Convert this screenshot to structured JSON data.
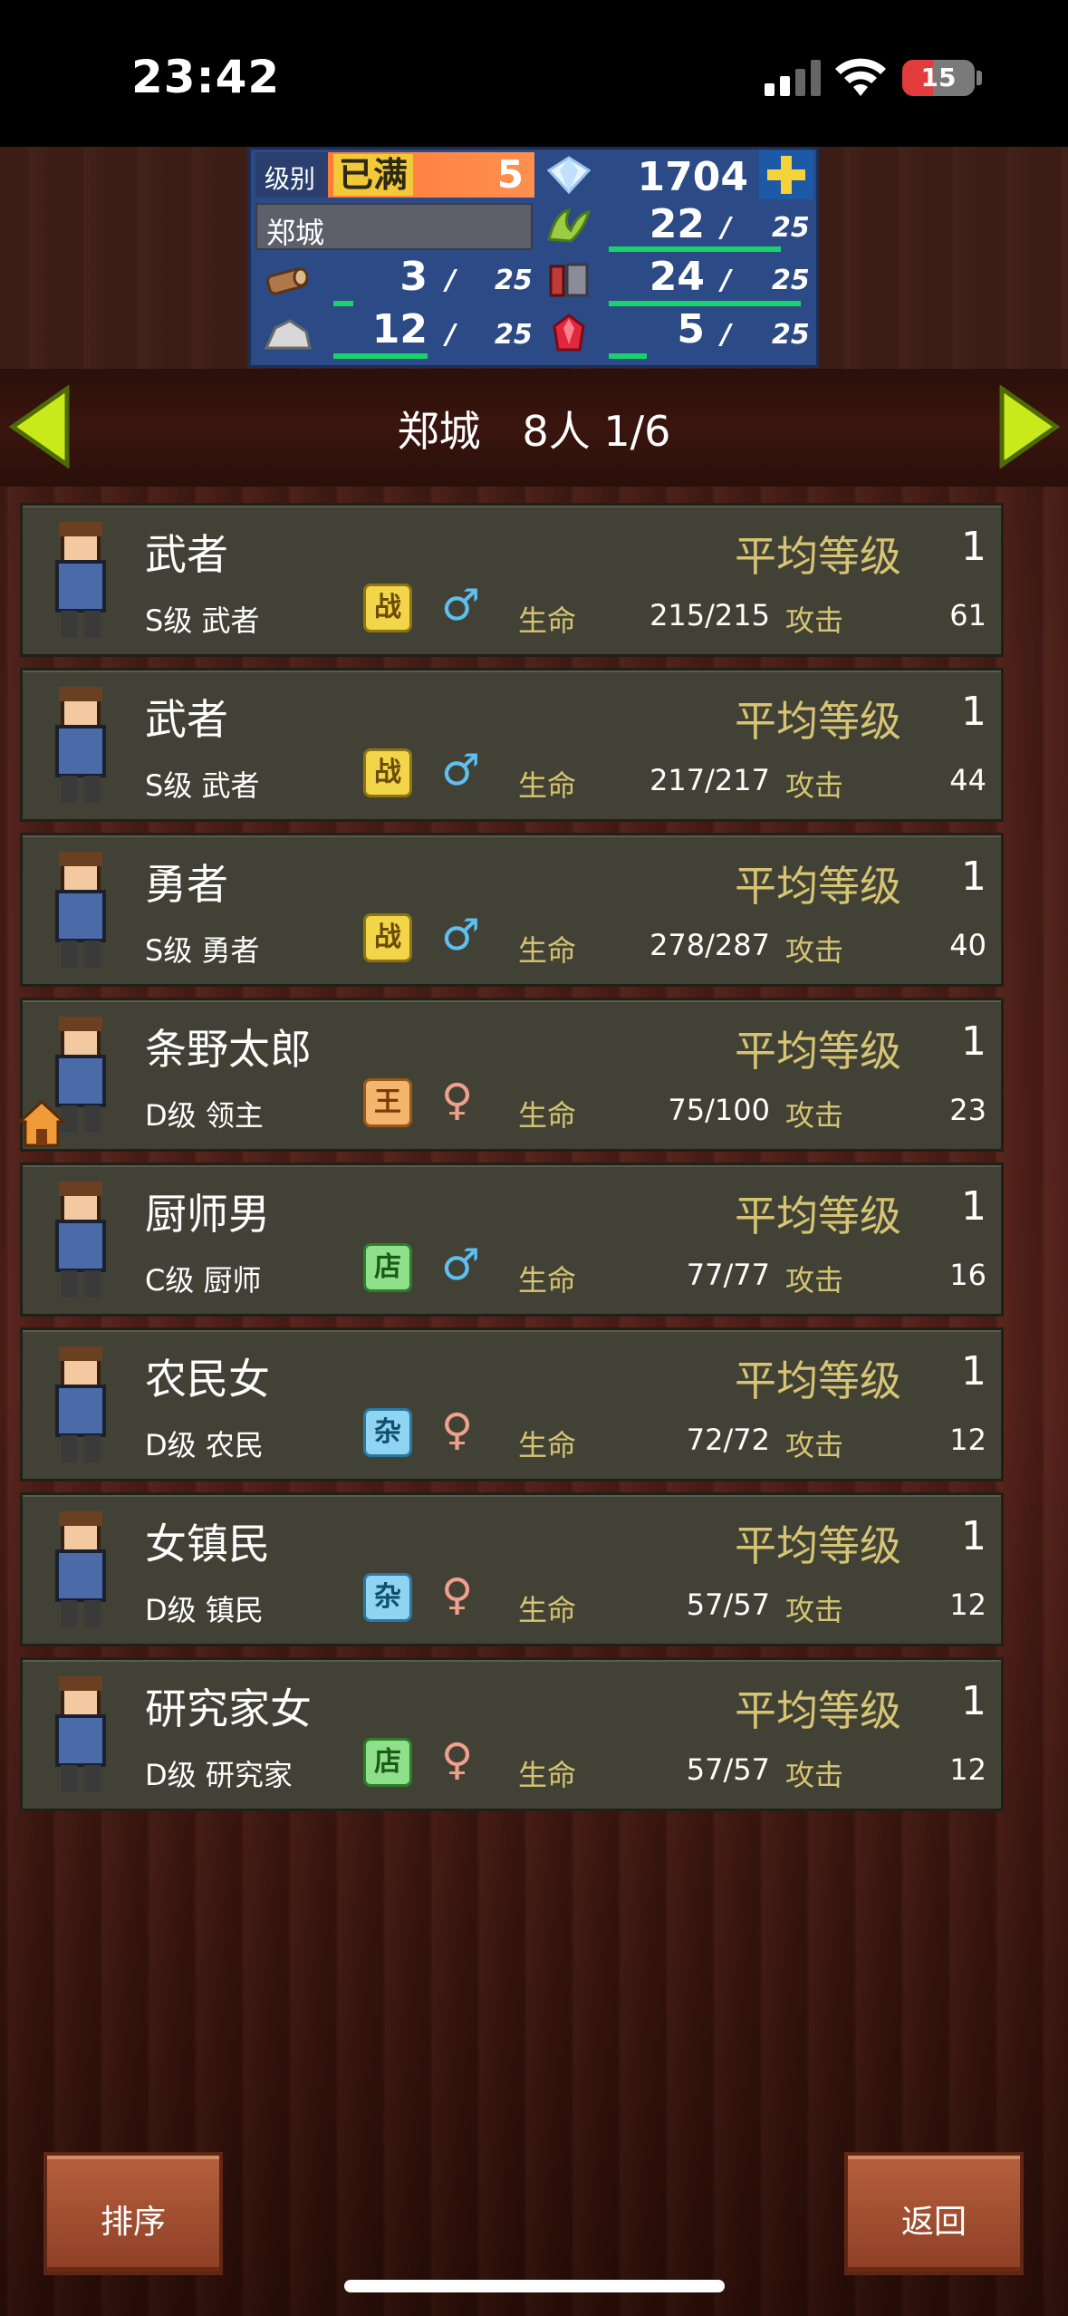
{
  "status_bar": {
    "time": "23:42",
    "battery": "15"
  },
  "resources": {
    "level_label": "级别",
    "level_status": "已满",
    "level_value": "5",
    "gems": "1704",
    "plus_icon": "plus-icon",
    "city_name": "郑城",
    "food": {
      "value": "22",
      "max": "25"
    },
    "wood": {
      "value": "3",
      "max": "25"
    },
    "materials": {
      "value": "24",
      "max": "25"
    },
    "stone": {
      "value": "12",
      "max": "25"
    },
    "ruby": {
      "value": "5",
      "max": "25"
    }
  },
  "title": "郑城　8人 1/6",
  "labels": {
    "avg_level": "平均等级",
    "hp": "生命",
    "attack": "攻击"
  },
  "residents": [
    {
      "name": "武者",
      "level": "1",
      "class": "S级 武者",
      "badge": "战",
      "badge_type": "zhan",
      "gender": "male",
      "hp": "215/215",
      "attack": "61"
    },
    {
      "name": "武者",
      "level": "1",
      "class": "S级 武者",
      "badge": "战",
      "badge_type": "zhan",
      "gender": "male",
      "hp": "217/217",
      "attack": "44"
    },
    {
      "name": "勇者",
      "level": "1",
      "class": "S级 勇者",
      "badge": "战",
      "badge_type": "zhan",
      "gender": "male",
      "hp": "278/287",
      "attack": "40"
    },
    {
      "name": "条野太郎",
      "level": "1",
      "class": "D级 领主",
      "badge": "王",
      "badge_type": "wang",
      "gender": "female",
      "hp": "75/100",
      "attack": "23"
    },
    {
      "name": "厨师男",
      "level": "1",
      "class": "C级 厨师",
      "badge": "店",
      "badge_type": "dian",
      "gender": "male",
      "hp": "77/77",
      "attack": "16"
    },
    {
      "name": "农民女",
      "level": "1",
      "class": "D级 农民",
      "badge": "杂",
      "badge_type": "za",
      "gender": "female",
      "hp": "72/72",
      "attack": "12"
    },
    {
      "name": "女镇民",
      "level": "1",
      "class": "D级 镇民",
      "badge": "杂",
      "badge_type": "za",
      "gender": "female",
      "hp": "57/57",
      "attack": "12"
    },
    {
      "name": "研究家女",
      "level": "1",
      "class": "D级 研究家",
      "badge": "店",
      "badge_type": "dian",
      "gender": "female",
      "hp": "57/57",
      "attack": "12"
    }
  ],
  "buttons": {
    "sort": "排序",
    "back": "返回"
  }
}
